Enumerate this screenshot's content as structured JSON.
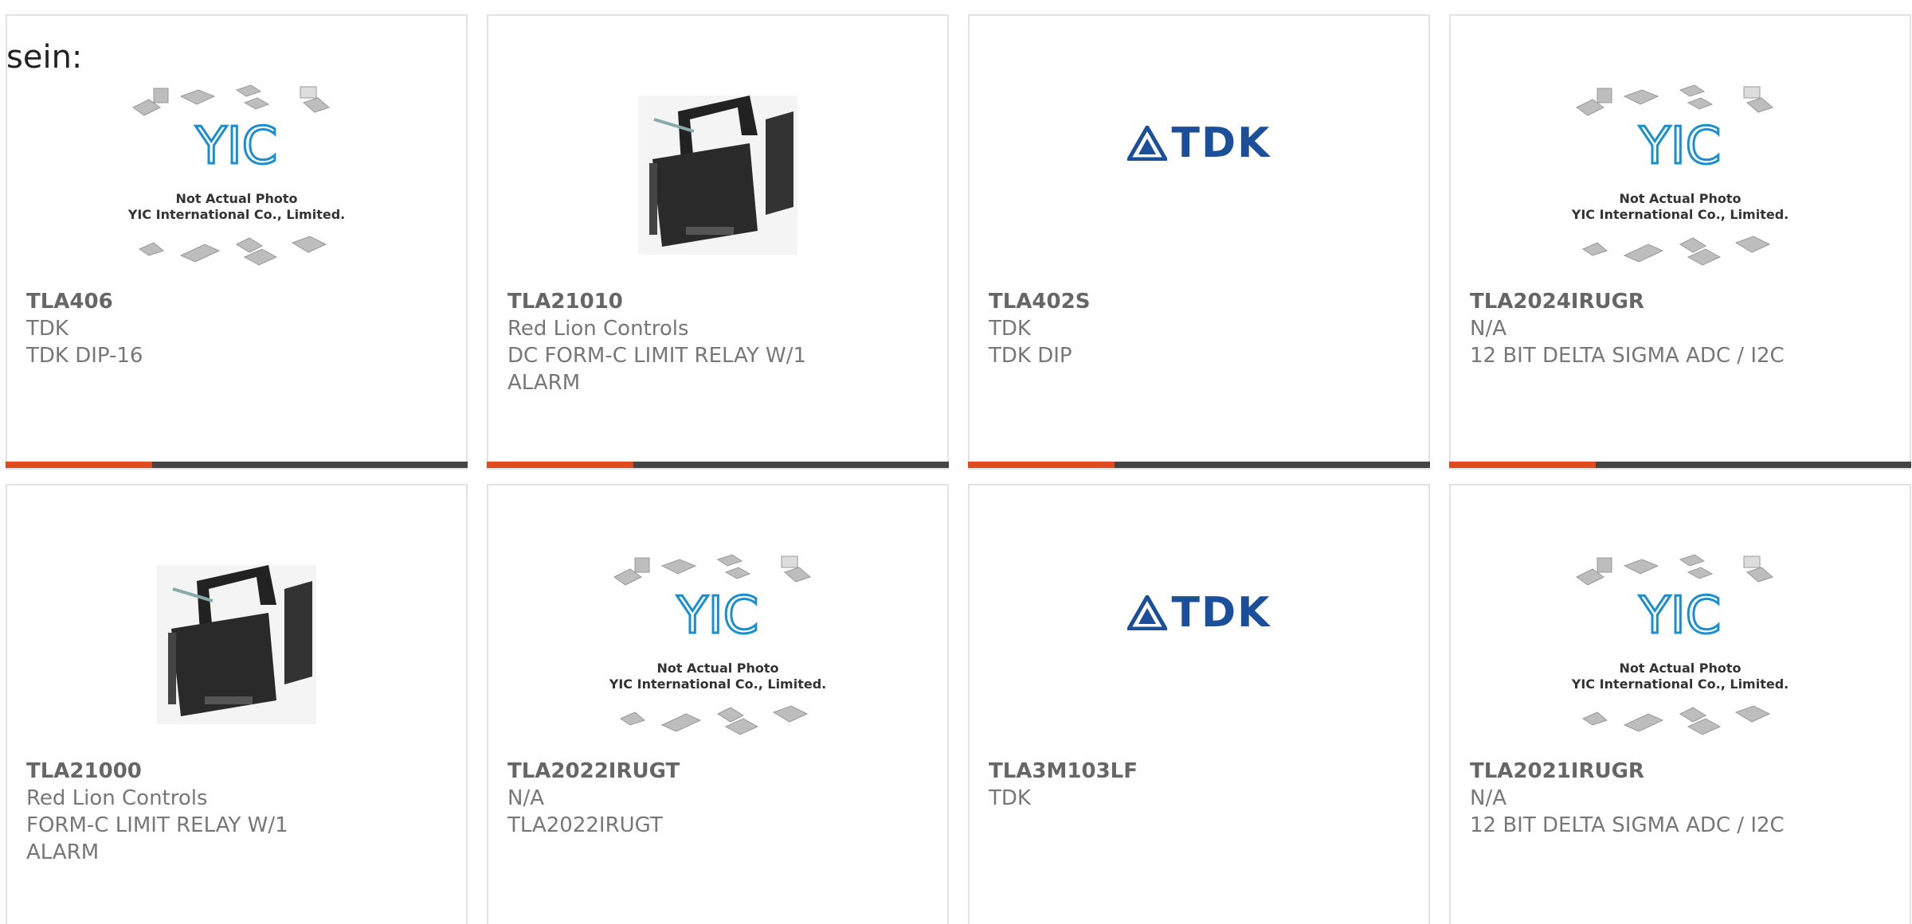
{
  "header": {
    "text": "sein:"
  },
  "placeholder": {
    "line1": "Not Actual Photo",
    "line2": "YIC International Co., Limited.",
    "logo": "YIC"
  },
  "tdk_logo": "TDK",
  "products": [
    {
      "part": "TLA406",
      "maker": "TDK",
      "desc": "TDK DIP-16",
      "image": "yic-placeholder"
    },
    {
      "part": "TLA21010",
      "maker": "Red Lion Controls",
      "desc": "DC FORM-C LIMIT RELAY W/1 ALARM",
      "image": "relay-photo"
    },
    {
      "part": "TLA402S",
      "maker": "TDK",
      "desc": "TDK DIP",
      "image": "tdk-logo"
    },
    {
      "part": "TLA2024IRUGR",
      "maker": "N/A",
      "desc": "12 BIT DELTA SIGMA ADC / I2C",
      "image": "yic-placeholder"
    },
    {
      "part": "TLA21000",
      "maker": "Red Lion Controls",
      "desc": "FORM-C LIMIT RELAY W/1 ALARM",
      "image": "relay-photo"
    },
    {
      "part": "TLA2022IRUGT",
      "maker": "N/A",
      "desc": "TLA2022IRUGT",
      "image": "yic-placeholder"
    },
    {
      "part": "TLA3M103LF",
      "maker": "TDK",
      "desc": "",
      "image": "tdk-logo"
    },
    {
      "part": "TLA2021IRUGR",
      "maker": "N/A",
      "desc": "12 BIT DELTA SIGMA ADC / I2C",
      "image": "yic-placeholder"
    }
  ],
  "colors": {
    "accent": "#e04a1f",
    "bar": "#444444",
    "tdk_blue": "#1b4f9a",
    "yic_blue": "#1a8fd0"
  }
}
